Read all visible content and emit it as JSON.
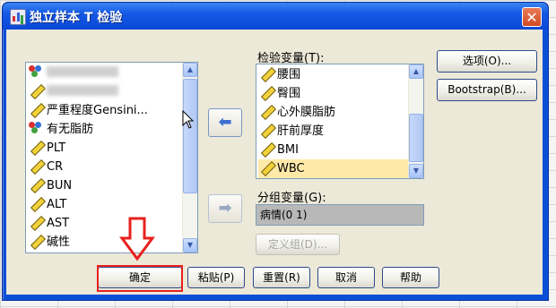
{
  "window": {
    "title": "独立样本 T 检验",
    "close_symbol": "✕"
  },
  "source_list": {
    "items": [
      {
        "label": "",
        "icon": "nominal-icon",
        "obscured": true
      },
      {
        "label": "",
        "icon": "ruler-icon",
        "obscured": true
      },
      {
        "label": "严重程度Gensini...",
        "icon": "ruler-icon"
      },
      {
        "label": "有无脂肪",
        "icon": "nominal-icon"
      },
      {
        "label": "PLT",
        "icon": "ruler-icon"
      },
      {
        "label": "CR",
        "icon": "ruler-icon"
      },
      {
        "label": "BUN",
        "icon": "ruler-icon"
      },
      {
        "label": "ALT",
        "icon": "ruler-icon"
      },
      {
        "label": "AST",
        "icon": "ruler-icon"
      },
      {
        "label": "碱性",
        "icon": "ruler-icon"
      }
    ]
  },
  "test_variables": {
    "label": "检验变量(T):",
    "items": [
      {
        "label": "腰围",
        "icon": "ruler-icon"
      },
      {
        "label": "臀围",
        "icon": "ruler-icon"
      },
      {
        "label": "心外膜脂肪",
        "icon": "ruler-icon"
      },
      {
        "label": "肝前厚度",
        "icon": "ruler-icon"
      },
      {
        "label": "BMI",
        "icon": "ruler-icon"
      },
      {
        "label": "WBC",
        "icon": "ruler-icon",
        "selected": true
      }
    ]
  },
  "grouping": {
    "label": "分组变量(G):",
    "value": "病情(0 1)",
    "define_groups_label": "定义组(D)..."
  },
  "side_buttons": {
    "options_label": "选项(O)...",
    "bootstrap_label": "Bootstrap(B)..."
  },
  "bottom_buttons": {
    "ok": "确定",
    "paste": "粘贴(P)",
    "reset": "重置(R)",
    "cancel": "取消",
    "help": "帮助"
  },
  "arrows": {
    "move_left_symbol": "⬅",
    "move_right_symbol": "➡"
  },
  "colors": {
    "title_bar": "#1559e6",
    "dialog_bg": "#ece9d8",
    "annotation_red": "#e8201c",
    "selected_item": "#ffe9a8"
  }
}
